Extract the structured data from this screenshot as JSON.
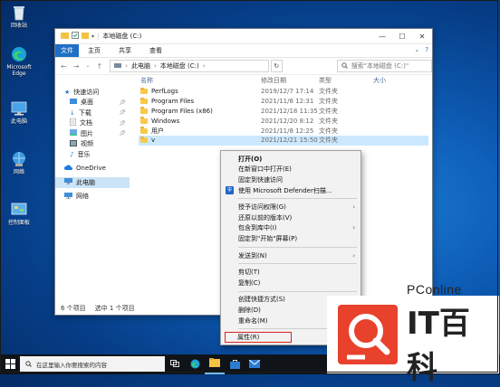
{
  "desktop": {
    "icons": [
      {
        "label": "回收站"
      },
      {
        "label": "Microsoft Edge"
      },
      {
        "label": "此电脑"
      },
      {
        "label": "网络"
      },
      {
        "label": "控制面板"
      }
    ]
  },
  "window": {
    "title": "本地磁盘 (C:)",
    "controls": {
      "minimize": "—",
      "maximize": "☐",
      "close": "✕"
    },
    "ribbon": {
      "file": "文件",
      "tabs": [
        "主页",
        "共享",
        "查看"
      ]
    },
    "address": {
      "path": [
        "此电脑",
        "本地磁盘 (C:)"
      ],
      "search_placeholder": "搜索\"本地磁盘 (C:)\""
    },
    "nav": [
      {
        "label": "快速访问",
        "type": "quick"
      },
      {
        "label": "桌面",
        "type": "sub",
        "pinned": true
      },
      {
        "label": "下载",
        "type": "sub",
        "pinned": true
      },
      {
        "label": "文档",
        "type": "sub",
        "pinned": true
      },
      {
        "label": "图片",
        "type": "sub",
        "pinned": true
      },
      {
        "label": "视频",
        "type": "sub"
      },
      {
        "label": "音乐",
        "type": "sub"
      },
      {
        "label": "OneDrive",
        "type": "onedrive"
      },
      {
        "label": "此电脑",
        "type": "pc",
        "selected": true
      },
      {
        "label": "网络",
        "type": "network"
      }
    ],
    "columns": {
      "name": "名称",
      "date": "修改日期",
      "type": "类型",
      "size": "大小"
    },
    "files": [
      {
        "name": "PerfLogs",
        "date": "2019/12/7 17:14",
        "type": "文件夹"
      },
      {
        "name": "Program Files",
        "date": "2021/11/8 12:31",
        "type": "文件夹"
      },
      {
        "name": "Program Files (x86)",
        "date": "2021/12/18 11:35",
        "type": "文件夹"
      },
      {
        "name": "Windows",
        "date": "2021/12/20 8:12",
        "type": "文件夹"
      },
      {
        "name": "用户",
        "date": "2021/11/8 12:25",
        "type": "文件夹"
      },
      {
        "name": "v",
        "date": "2021/12/21 15:50",
        "type": "文件夹",
        "selected": true
      }
    ],
    "status": {
      "count": "6 个项目",
      "selected": "选中 1 个项目"
    }
  },
  "context_menu": {
    "items": [
      {
        "label": "打开(O)",
        "bold": true
      },
      {
        "label": "在新窗口中打开(E)"
      },
      {
        "label": "固定到快速访问"
      },
      {
        "label": "使用 Microsoft Defender扫描...",
        "icon": "defender-shield-icon"
      },
      {
        "sep": true
      },
      {
        "label": "授予访问权限(G)",
        "submenu": true
      },
      {
        "label": "还原以前的版本(V)"
      },
      {
        "label": "包含到库中(I)",
        "submenu": true
      },
      {
        "label": "固定到\"开始\"屏幕(P)"
      },
      {
        "sep": true
      },
      {
        "label": "发送到(N)",
        "submenu": true
      },
      {
        "sep": true
      },
      {
        "label": "剪切(T)"
      },
      {
        "label": "复制(C)"
      },
      {
        "sep": true
      },
      {
        "label": "创建快捷方式(S)"
      },
      {
        "label": "删除(D)"
      },
      {
        "label": "重命名(M)"
      },
      {
        "sep": true
      },
      {
        "label": "属性(R)",
        "highlighted": true
      }
    ]
  },
  "taskbar": {
    "search_placeholder": "在这里输入你要搜索的内容"
  },
  "watermark": {
    "brand": "PConline",
    "big": "IT百科"
  },
  "colors": {
    "accent": "#1f6fc5",
    "selection": "#cce8ff",
    "highlight_box": "#e02020"
  }
}
